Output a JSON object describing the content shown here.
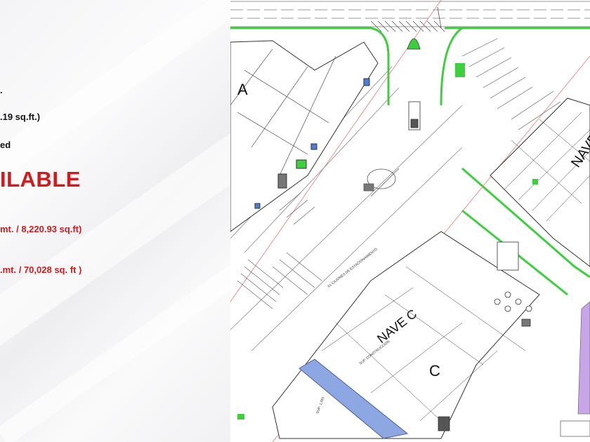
{
  "info": {
    "line_area_total": ".19 sq.ft.)",
    "line_status": "ed",
    "availability": "ILABLE",
    "line_available_area": "mt. /  8,220.93 sq.ft)",
    "line_total_area": ".mt. / 70,028 sq. ft )"
  },
  "plan": {
    "building_a": "A",
    "building_c": "C",
    "nave_c": "NAVE C",
    "nave_right": "NAVE",
    "parking_note": "61 CAJONES DE ESTACIONAMIENTO",
    "sup_label": "SUP: 1,091",
    "construction_label": "SUP. CONSTRUCCION",
    "colors": {
      "available_unit": "#8da7e3",
      "green_area": "#3ecf3e",
      "highlight_red": "#d21a1a",
      "line": "#333333"
    }
  }
}
